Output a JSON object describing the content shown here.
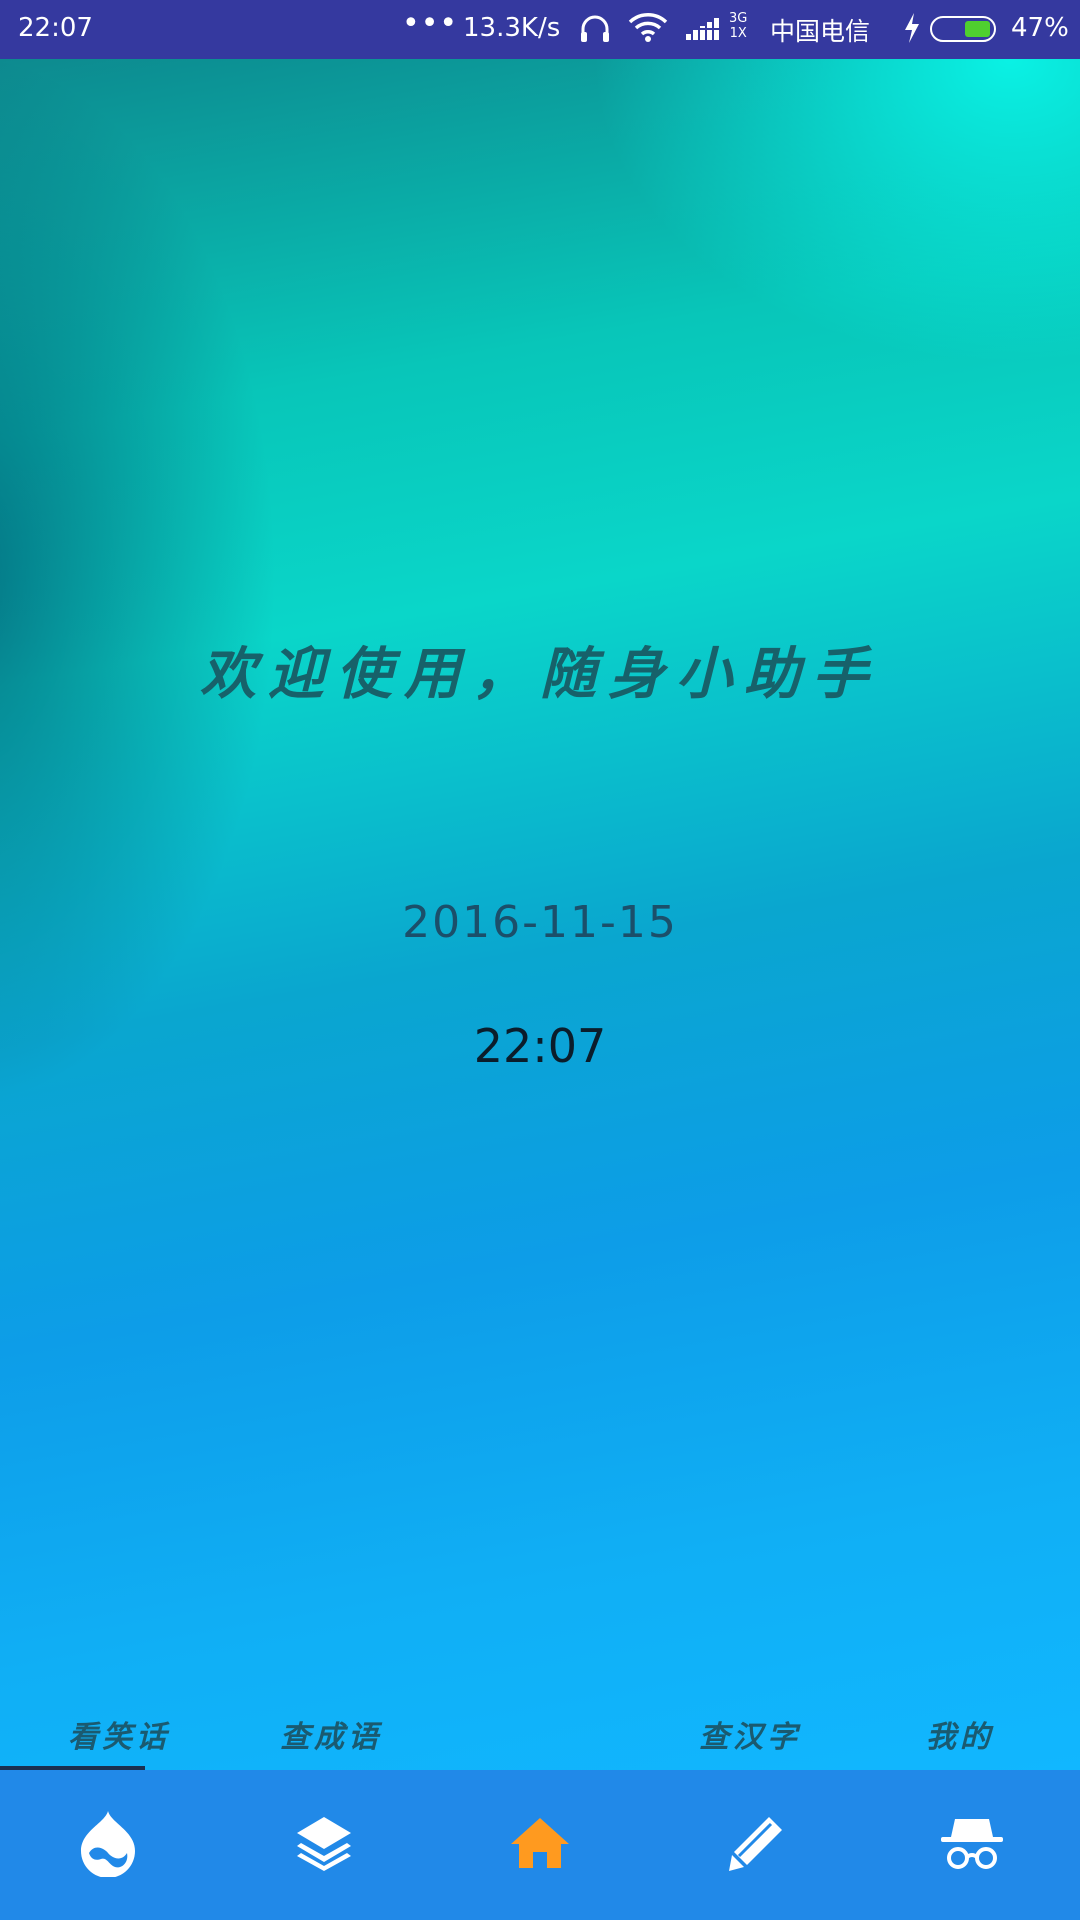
{
  "status_bar": {
    "time": "22:07",
    "dots": "•••",
    "speed": "13.3K/s",
    "net_type_top": "3G",
    "net_type_bottom": "1X",
    "carrier": "中国电信",
    "battery_percent": "47%",
    "battery_level": 0.47
  },
  "main": {
    "welcome": "欢迎使用，随身小助手",
    "date": "2016-11-15",
    "clock": "22:07"
  },
  "tabs": [
    {
      "label": "看笑话",
      "selected": true
    },
    {
      "label": "查成语",
      "selected": false
    },
    {
      "label": "",
      "selected": false
    },
    {
      "label": "查汉字",
      "selected": false
    },
    {
      "label": "我的",
      "selected": false
    }
  ],
  "bottom_nav": [
    {
      "icon": "drupal-icon",
      "color": "#ffffff"
    },
    {
      "icon": "layers-icon",
      "color": "#ffffff"
    },
    {
      "icon": "home-icon",
      "color": "#ff9a1f"
    },
    {
      "icon": "pencil-icon",
      "color": "#ffffff"
    },
    {
      "icon": "incognito-icon",
      "color": "#ffffff"
    }
  ],
  "colors": {
    "status_bar": "#35399f",
    "nav_bar": "#2189e8",
    "active_accent": "#ff9a1f"
  }
}
